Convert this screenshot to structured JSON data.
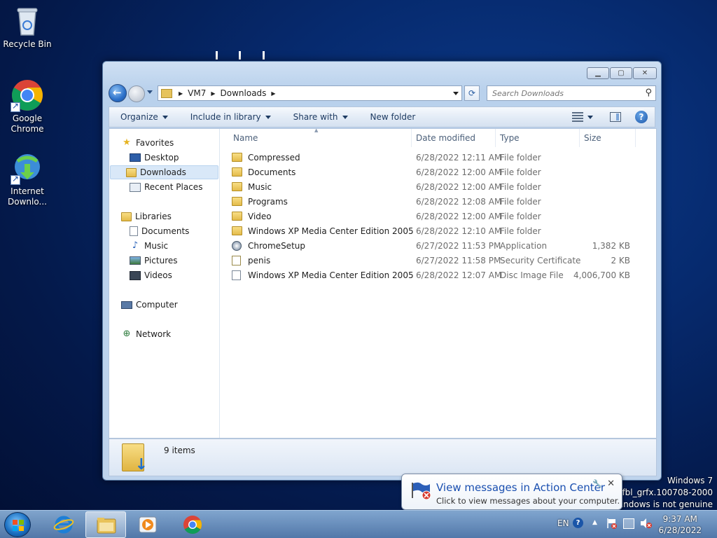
{
  "desktop": {
    "icons": [
      {
        "label": "Recycle Bin"
      },
      {
        "label": "Google Chrome"
      },
      {
        "label": "Internet Downlo..."
      }
    ]
  },
  "window": {
    "breadcrumb": [
      "VM7",
      "Downloads"
    ],
    "search_placeholder": "Search Downloads",
    "toolbar": {
      "organize": "Organize",
      "include": "Include in library",
      "share": "Share with",
      "new_folder": "New folder"
    },
    "nav": {
      "favorites": "Favorites",
      "desktop": "Desktop",
      "downloads": "Downloads",
      "recent": "Recent Places",
      "libraries": "Libraries",
      "documents": "Documents",
      "music": "Music",
      "pictures": "Pictures",
      "videos": "Videos",
      "computer": "Computer",
      "network": "Network"
    },
    "columns": {
      "name": "Name",
      "date": "Date modified",
      "type": "Type",
      "size": "Size"
    },
    "files": [
      {
        "name": "Compressed",
        "date": "6/28/2022 12:11 AM",
        "type": "File folder",
        "size": "",
        "icon": "folder-icon"
      },
      {
        "name": "Documents",
        "date": "6/28/2022 12:00 AM",
        "type": "File folder",
        "size": "",
        "icon": "folder-icon"
      },
      {
        "name": "Music",
        "date": "6/28/2022 12:00 AM",
        "type": "File folder",
        "size": "",
        "icon": "folder-icon"
      },
      {
        "name": "Programs",
        "date": "6/28/2022 12:08 AM",
        "type": "File folder",
        "size": "",
        "icon": "folder-icon"
      },
      {
        "name": "Video",
        "date": "6/28/2022 12:00 AM",
        "type": "File folder",
        "size": "",
        "icon": "folder-icon"
      },
      {
        "name": "Windows XP Media Center Edition 2005",
        "date": "6/28/2022 12:10 AM",
        "type": "File folder",
        "size": "",
        "icon": "folder-icon"
      },
      {
        "name": "ChromeSetup",
        "date": "6/27/2022 11:53 PM",
        "type": "Application",
        "size": "1,382 KB",
        "icon": "application-icon"
      },
      {
        "name": "penis",
        "date": "6/27/2022 11:58 PM",
        "type": "Security Certificate",
        "size": "2 KB",
        "icon": "certificate-icon"
      },
      {
        "name": "Windows XP Media Center Edition 2005",
        "date": "6/28/2022 12:07 AM",
        "type": "Disc Image File",
        "size": "4,006,700 KB",
        "icon": "disc-image-icon"
      }
    ],
    "item_count": "9 items"
  },
  "balloon": {
    "title": "View messages in Action Center",
    "message": "Click to view messages about your computer."
  },
  "watermark": {
    "line1": "Windows 7",
    "line2": "777.fbl_grfx.100708-2000",
    "line3": "Windows is not genuine"
  },
  "taskbar": {
    "language": "EN",
    "time": "9:37 AM",
    "date": "6/28/2022"
  },
  "colors": {
    "accent": "#1a4fb0",
    "folder": "#e4bb4a"
  }
}
